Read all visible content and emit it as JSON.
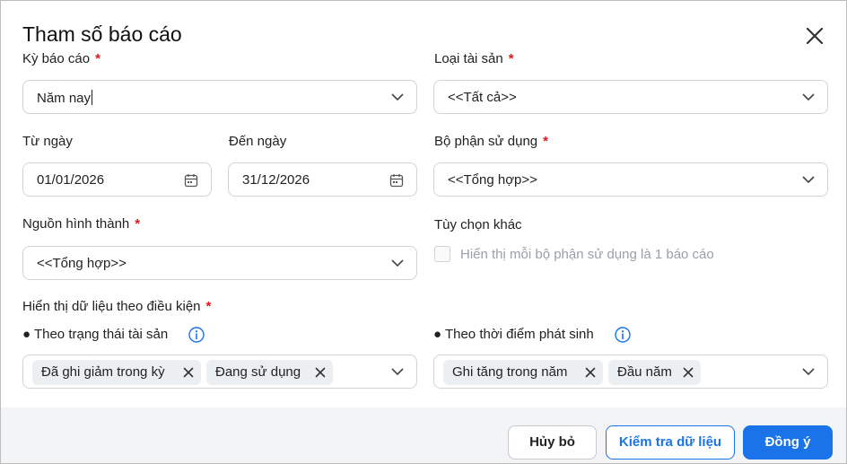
{
  "dialog": {
    "title": "Tham số báo cáo"
  },
  "report_period": {
    "label": "Kỳ báo cáo",
    "required": "*",
    "value": "Năm nay"
  },
  "asset_type": {
    "label": "Loại tài sản",
    "required": "*",
    "value": "<<Tất cả>>"
  },
  "from_date": {
    "label": "Từ ngày",
    "value": "01/01/2026"
  },
  "to_date": {
    "label": "Đến ngày",
    "value": "31/12/2026"
  },
  "department": {
    "label": "Bộ phận sử dụng",
    "required": "*",
    "value": "<<Tổng hợp>>"
  },
  "source": {
    "label": "Nguồn hình thành",
    "required": "*",
    "value": "<<Tổng hợp>>"
  },
  "other_options": {
    "label": "Tùy chọn khác",
    "checkbox_label": "Hiển thị mỗi bộ phận sử dụng là 1 báo cáo",
    "checked": false
  },
  "condition": {
    "label": "Hiển thị dữ liệu theo điều kiện",
    "required": "*",
    "asset_status": {
      "label": "● Theo trạng thái tài sản",
      "tags": [
        "Đã ghi giảm trong kỳ",
        "Đang sử dụng"
      ]
    },
    "occurrence_time": {
      "label": "● Theo thời điểm phát sinh",
      "tags": [
        "Ghi tăng trong năm",
        "Đầu năm"
      ]
    }
  },
  "buttons": {
    "cancel": "Hủy bỏ",
    "check_data": "Kiểm tra dữ liệu",
    "ok": "Đồng ý"
  },
  "icons": {
    "close": "close-icon",
    "chevron": "chevron-down-icon",
    "calendar": "calendar-icon",
    "info": "info-icon",
    "remove_tag": "remove-tag-icon"
  },
  "colors": {
    "accent": "#1a73e8",
    "required": "#e0161c",
    "tag_bg": "#eceff1",
    "footer_bg": "#f3f4f6"
  }
}
